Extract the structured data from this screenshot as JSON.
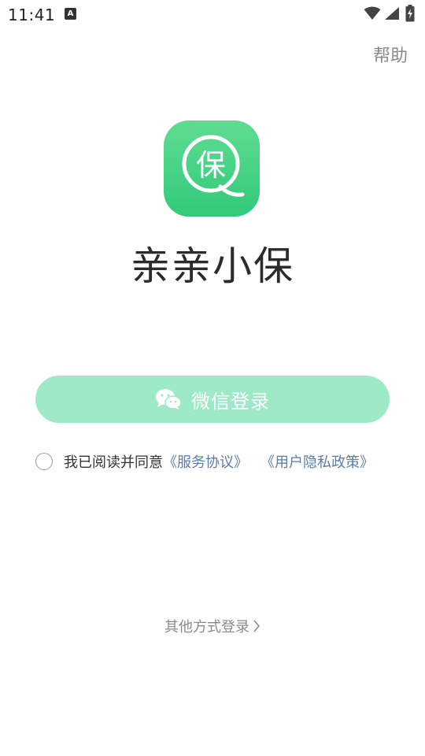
{
  "status_bar": {
    "time": "11:41",
    "notification_icon": "a-letter-icon",
    "notification_label": "A",
    "icons": [
      "wifi-icon",
      "signal-icon",
      "battery-charging-icon"
    ]
  },
  "header": {
    "help_label": "帮助"
  },
  "logo": {
    "icon": "bao-logo-icon",
    "glyph": "保",
    "app_name": "亲亲小保",
    "gradient_top": "#5fdc92",
    "gradient_bottom": "#32c97a"
  },
  "login": {
    "wechat_label": "微信登录",
    "wechat_icon": "wechat-icon",
    "button_color": "#9ee9c8"
  },
  "agreement": {
    "prefix": "我已阅读并同意",
    "service_link": "《服务协议》",
    "privacy_link": "《用户隐私政策》",
    "link_color": "#5a7da8"
  },
  "footer": {
    "other_login_label": "其他方式登录"
  }
}
